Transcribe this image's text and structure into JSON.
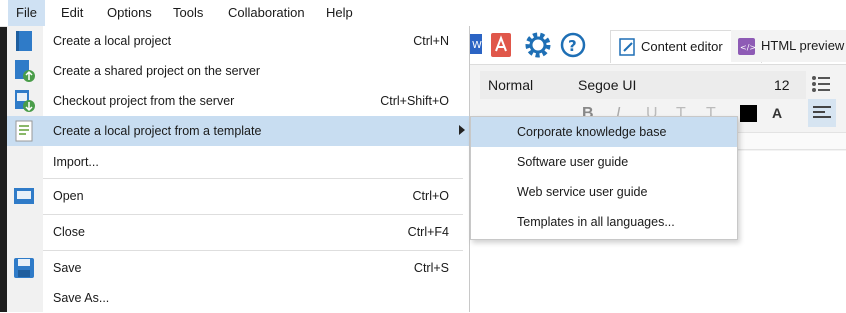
{
  "menubar": {
    "items": [
      {
        "label": "File",
        "active": true
      },
      {
        "label": "Edit"
      },
      {
        "label": "Options"
      },
      {
        "label": "Tools"
      },
      {
        "label": "Collaboration"
      },
      {
        "label": "Help"
      }
    ]
  },
  "file_menu": {
    "items": [
      {
        "label": "Create a local project",
        "shortcut": "Ctrl+N",
        "icon": "new-project-icon"
      },
      {
        "label": "Create a shared project on the server",
        "shortcut": "",
        "icon": "upload-project-icon"
      },
      {
        "label": "Checkout project from the server",
        "shortcut": "Ctrl+Shift+O",
        "icon": "checkout-project-icon"
      },
      {
        "label": "Create a local project from a template",
        "shortcut": "",
        "icon": "template-icon",
        "has_submenu": true,
        "selected": true
      },
      {
        "label": "Import...",
        "shortcut": ""
      },
      {
        "label": "Open",
        "shortcut": "Ctrl+O",
        "icon": "folder-open-icon"
      },
      {
        "label": "Close",
        "shortcut": "Ctrl+F4"
      },
      {
        "label": "Save",
        "shortcut": "Ctrl+S",
        "icon": "save-icon"
      },
      {
        "label": "Save As...",
        "shortcut": ""
      }
    ]
  },
  "template_submenu": {
    "items": [
      {
        "label": "Corporate knowledge base",
        "selected": true
      },
      {
        "label": "Software user guide"
      },
      {
        "label": "Web service user guide"
      },
      {
        "label": "Templates in all languages..."
      }
    ]
  },
  "editor": {
    "tabs": [
      {
        "label": "Content editor",
        "active": true
      },
      {
        "label": "HTML preview"
      }
    ],
    "format": {
      "style": "Normal",
      "font": "Segoe UI",
      "size": "12"
    },
    "toolbar_icons": [
      "word-export-icon",
      "pdf-export-icon",
      "settings-gear-icon",
      "help-icon"
    ],
    "colors": {
      "accent": "#1e6fb5",
      "selection": "#c8ddf1"
    }
  }
}
